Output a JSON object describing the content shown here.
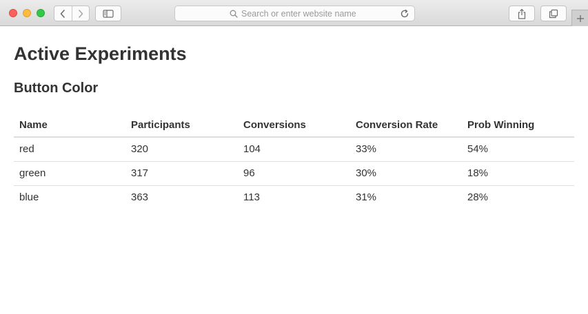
{
  "browser": {
    "search_placeholder": "Search or enter website name",
    "colors": {
      "close": "#fc605c",
      "minimize": "#fdbc40",
      "maximize": "#34c84a"
    },
    "icons": {
      "back": "chevron-left-icon",
      "forward": "chevron-right-icon",
      "sidebar": "sidebar-icon",
      "search": "search-icon",
      "reload": "reload-icon",
      "share": "share-icon",
      "tabs": "tabs-overview-icon",
      "new_tab": "plus-icon"
    }
  },
  "page": {
    "title": "Active Experiments",
    "experiment": {
      "name": "Button Color",
      "columns": [
        "Name",
        "Participants",
        "Conversions",
        "Conversion Rate",
        "Prob Winning"
      ],
      "rows": [
        [
          "red",
          "320",
          "104",
          "33%",
          "54%"
        ],
        [
          "green",
          "317",
          "96",
          "30%",
          "18%"
        ],
        [
          "blue",
          "363",
          "113",
          "31%",
          "28%"
        ]
      ]
    }
  }
}
